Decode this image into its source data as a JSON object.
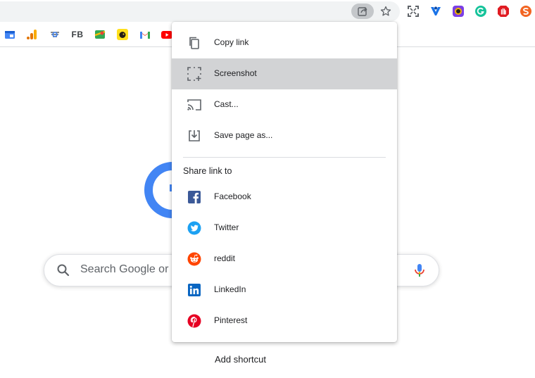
{
  "toolbar": {
    "share_icon": "share-page-icon",
    "star_icon": "bookmark-star-icon",
    "extensions": [
      {
        "name": "fullscreen-icon",
        "color": "#5f6368"
      },
      {
        "name": "vpn-shield-icon",
        "color": "#1a73e8"
      },
      {
        "name": "color-picker-icon",
        "color": "#7b3fe4"
      },
      {
        "name": "grammarly-icon",
        "color": "#15c39a"
      },
      {
        "name": "adblock-hand-icon",
        "color": "#e01b22"
      },
      {
        "name": "s-extension-icon",
        "color": "#f26522"
      }
    ]
  },
  "bookmarks": {
    "fb_label": "FB"
  },
  "page": {
    "search_placeholder": "Search Google or type a URL",
    "add_shortcut": "Add shortcut"
  },
  "menu": {
    "items": [
      {
        "label": "Copy link",
        "icon": "copy-icon"
      },
      {
        "label": "Screenshot",
        "icon": "screenshot-icon",
        "highlighted": true
      },
      {
        "label": "Cast...",
        "icon": "cast-icon"
      },
      {
        "label": "Save page as...",
        "icon": "save-page-icon"
      }
    ],
    "share_section_title": "Share link to",
    "share_targets": [
      {
        "label": "Facebook",
        "icon": "facebook-icon",
        "color": "#3b5998"
      },
      {
        "label": "Twitter",
        "icon": "twitter-icon",
        "color": "#1da1f2"
      },
      {
        "label": "reddit",
        "icon": "reddit-icon",
        "color": "#ff4500"
      },
      {
        "label": "LinkedIn",
        "icon": "linkedin-icon",
        "color": "#0a66c2"
      },
      {
        "label": "Pinterest",
        "icon": "pinterest-icon",
        "color": "#e60023"
      }
    ]
  }
}
